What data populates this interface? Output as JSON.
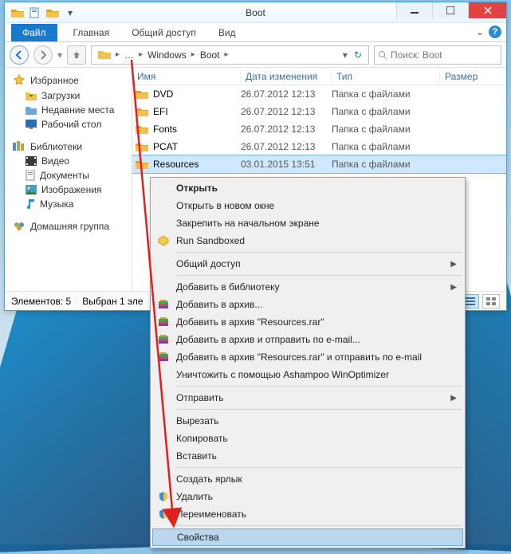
{
  "window": {
    "title": "Boot",
    "file_tab": "Файл",
    "tabs": [
      "Главная",
      "Общий доступ",
      "Вид"
    ]
  },
  "address": {
    "crumbs": [
      "Windows",
      "Boot"
    ],
    "search_placeholder": "Поиск: Boot"
  },
  "navpane": {
    "favorites": {
      "label": "Избранное",
      "items": [
        "Загрузки",
        "Недавние места",
        "Рабочий стол"
      ]
    },
    "libraries": {
      "label": "Библиотеки",
      "items": [
        "Видео",
        "Документы",
        "Изображения",
        "Музыка"
      ]
    },
    "homegroup": "Домашняя группа"
  },
  "columns": {
    "name": "Имя",
    "date": "Дата изменения",
    "type": "Тип",
    "size": "Размер"
  },
  "rows": [
    {
      "name": "DVD",
      "date": "26.07.2012 12:13",
      "type": "Папка с файлами"
    },
    {
      "name": "EFI",
      "date": "26.07.2012 12:13",
      "type": "Папка с файлами"
    },
    {
      "name": "Fonts",
      "date": "26.07.2012 12:13",
      "type": "Папка с файлами"
    },
    {
      "name": "PCAT",
      "date": "26.07.2012 12:13",
      "type": "Папка с файлами"
    },
    {
      "name": "Resources",
      "date": "03.01.2015 13:51",
      "type": "Папка с файлами",
      "selected": true
    }
  ],
  "status": {
    "count": "Элементов: 5",
    "selection": "Выбран 1 эле"
  },
  "context_menu": {
    "open": "Открыть",
    "open_new": "Открыть в новом окне",
    "pin_start": "Закрепить на начальном экране",
    "run_sandboxed": "Run Sandboxed",
    "sharing": "Общий доступ",
    "add_library": "Добавить в библиотеку",
    "add_archive": "Добавить в архив...",
    "add_archive_named": "Добавить в архив \"Resources.rar\"",
    "add_archive_email": "Добавить в архив и отправить по e-mail...",
    "add_archive_named_email": "Добавить в архив \"Resources.rar\" и отправить по e-mail",
    "destroy": "Уничтожить с помощью Ashampoo WinOptimizer",
    "send_to": "Отправить",
    "cut": "Вырезать",
    "copy": "Копировать",
    "paste": "Вставить",
    "shortcut": "Создать ярлык",
    "delete": "Удалить",
    "rename": "Переименовать",
    "properties": "Свойства"
  }
}
